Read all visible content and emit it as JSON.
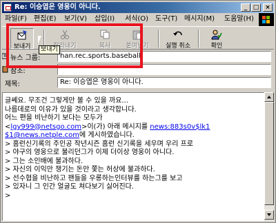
{
  "window": {
    "title": "Re: 이승엽은 영웅이 아니다.",
    "minimize_glyph": "_",
    "maximize_glyph": "□",
    "close_glyph": "×"
  },
  "menu": [
    "파일(F)",
    "편집(E)",
    "보기(V)",
    "삽입(I)",
    "서식(O)",
    "도구(T)",
    "메시지(M)",
    "도움말(H)"
  ],
  "toolbar": {
    "buttons": [
      {
        "label": "보내기",
        "icon": "send-icon"
      },
      {
        "label": "잘라내기",
        "icon": "cut-icon"
      },
      {
        "label": "복사",
        "icon": "copy-icon"
      },
      {
        "label": "붙여넣기",
        "icon": "paste-icon"
      },
      {
        "label": "실행 취소",
        "icon": "undo-icon"
      },
      {
        "label": "확인",
        "icon": "check-names-icon"
      }
    ],
    "tooltip": "보내기"
  },
  "header": {
    "newsgroups_label": "뉴스 그룹:",
    "newsgroups_value": "han.rec.sports.baseball",
    "cc_label": "참조:",
    "cc_value": "",
    "subject_label": "제목:",
    "subject_value": "Re: 이승엽은 영웅이 아니다."
  },
  "body": {
    "line1": "글쎄요. 무조건 그렇게만 볼 수 있을 까요...",
    "line2": "나름데로의 이유가 있을 것이라고 생각합니다.",
    "line3": "어느 편을 비난하기 보다는 모두가",
    "line4_pre": "<",
    "line4_email": "lgy999@netsgo.com",
    "line4_mid": ">이(가) 아래 메시지를 ",
    "line4_news": "news:883s0v$lk1",
    "line5_news": "$1@news.netple.com",
    "line5_post": "에 게시하였습니다.",
    "line6": "> 홈런신기록의 주인공 작년시즌 홈런 신기록을 세우며 우리 프로",
    "line7": "> 야구의 영웅으로 불리던그가 이제 더이상 영웅이 아니다.",
    "line8": "> 그는 소인배에 불과하다.",
    "line9": "> 자신의 이익만 챙기는 돈만 쫓는 허상에 불과하다.",
    "line10": "> 선수협을 비난하고 팬들을 우롱하는인터뷰를 하는그를 보고",
    "line11": "> 있자니 그 인간 얼굴도 쳐다보기 싫어진다.",
    "line12": ">"
  },
  "colors": {
    "highlight": "#e8141e",
    "titlebar": "#0a246a",
    "link": "#0000ee"
  }
}
